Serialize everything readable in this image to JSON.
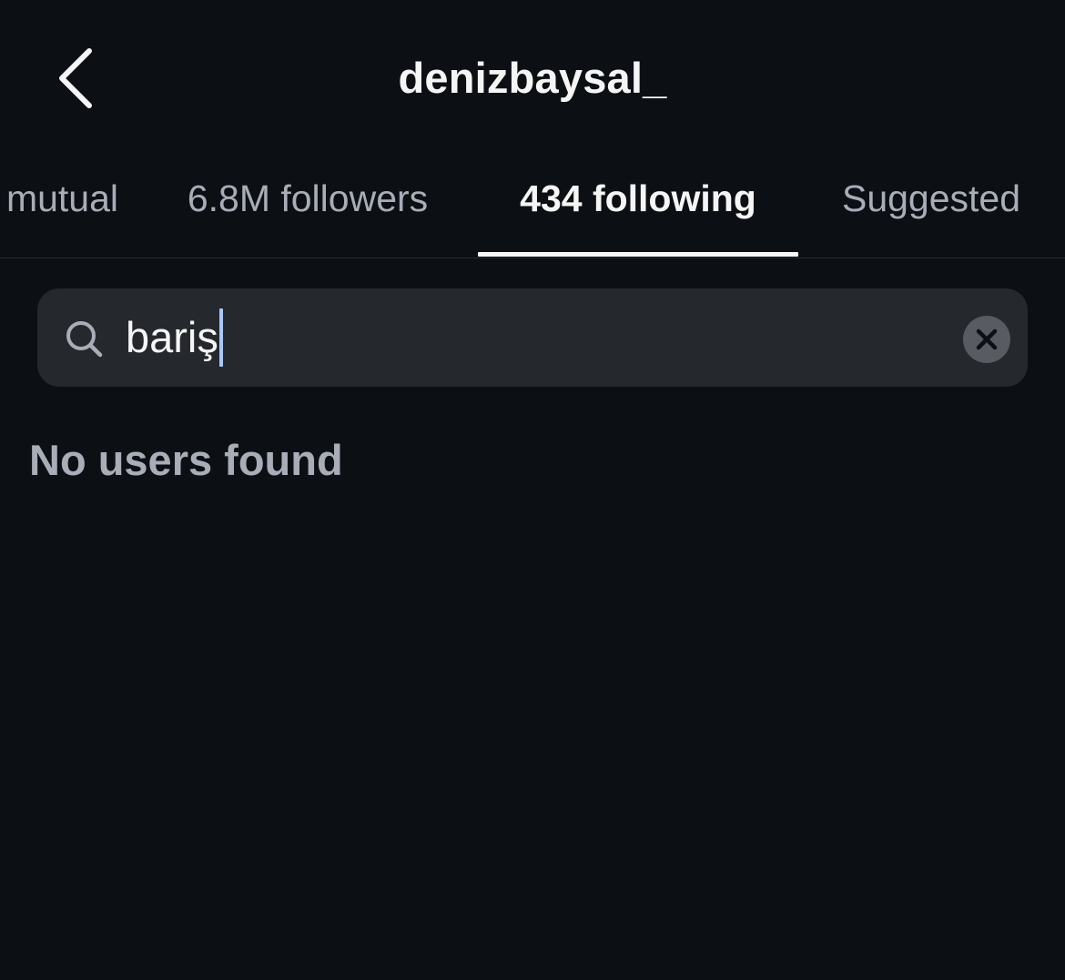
{
  "header": {
    "title": "denizbaysal_",
    "back_icon": "chevron-left-icon"
  },
  "tabs": [
    {
      "label": "mutual",
      "active": false
    },
    {
      "label": "6.8M followers",
      "active": false
    },
    {
      "label": "434 following",
      "active": true
    },
    {
      "label": "Suggested",
      "active": false
    }
  ],
  "search": {
    "value": "bariş",
    "icon": "search-icon",
    "clear_icon": "clear-icon"
  },
  "results": {
    "empty_message": "No users found"
  },
  "colors": {
    "background": "#0c1014",
    "search_background": "#25292e",
    "muted_text": "#a8adb8",
    "primary_text": "#f5f5f5",
    "caret": "#a8c7fa"
  }
}
